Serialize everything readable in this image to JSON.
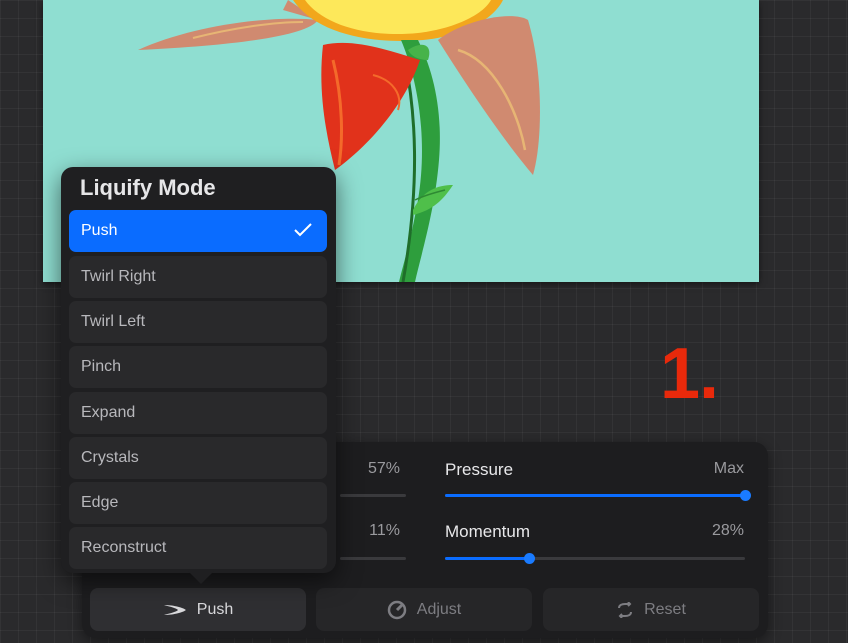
{
  "popover": {
    "title": "Liquify Mode",
    "modes": [
      {
        "label": "Push",
        "selected": true
      },
      {
        "label": "Twirl Right",
        "selected": false
      },
      {
        "label": "Twirl Left",
        "selected": false
      },
      {
        "label": "Pinch",
        "selected": false
      },
      {
        "label": "Expand",
        "selected": false
      },
      {
        "label": "Crystals",
        "selected": false
      },
      {
        "label": "Edge",
        "selected": false
      },
      {
        "label": "Reconstruct",
        "selected": false
      }
    ]
  },
  "panel": {
    "hidden_values": [
      "57%",
      "11%"
    ],
    "pressure": {
      "label": "Pressure",
      "value_text": "Max",
      "level": 1.0
    },
    "momentum": {
      "label": "Momentum",
      "value_text": "28%",
      "level": 0.28
    },
    "buttons": {
      "push": "Push",
      "adjust": "Adjust",
      "reset": "Reset"
    }
  },
  "annotation": {
    "step": "1."
  },
  "colors": {
    "accent": "#0a6cff",
    "canvas_background": "#8fded1",
    "annotation": "#e8290b",
    "panel": "#1d1d1f"
  },
  "icons": {
    "check": "checkmark-icon",
    "push": "push-swoosh-icon",
    "adjust": "adjust-dial-icon",
    "reset": "reset-arrows-icon"
  }
}
